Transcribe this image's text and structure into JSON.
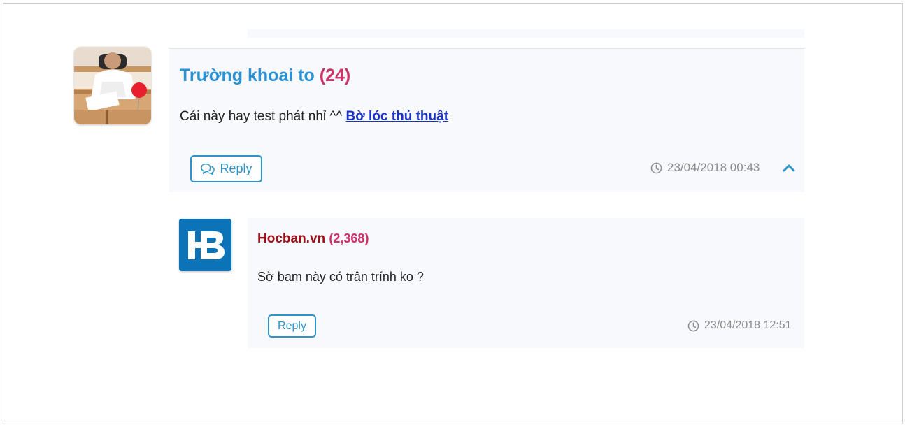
{
  "comment": {
    "author": "Trường khoai to",
    "points": "(24)",
    "text": "Cái này hay test phát nhỉ ^^ ",
    "link_text": "Bờ lóc thủ thuật",
    "reply_label": "Reply",
    "timestamp": "23/04/2018 00:43",
    "avatar_icon": "user-photo-avatar",
    "collapse_icon": "chevron-up-icon"
  },
  "reply": {
    "author": "Hocban.vn",
    "points": "(2,368)",
    "text": "Sờ bam này có trân trính ko ?",
    "reply_label": "Reply",
    "timestamp": "23/04/2018 12:51",
    "avatar_icon": "hocban-logo-avatar"
  },
  "colors": {
    "author_main": "#2a92d4",
    "author_reply": "#a00f18",
    "points": "#cc3366",
    "link": "#1a33c8",
    "button": "#2e93c9",
    "card_bg": "#f8f9fc",
    "muted": "#8a8a8a"
  }
}
